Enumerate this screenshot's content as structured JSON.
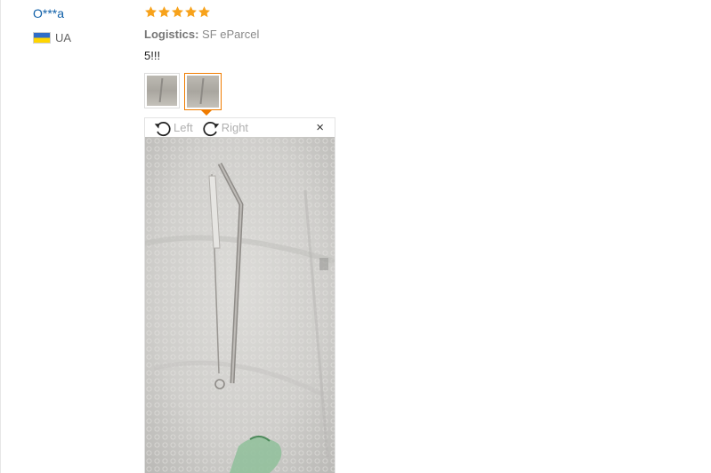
{
  "review": {
    "user_name": "O***a",
    "country_code": "UA",
    "rating": 5,
    "star_color": "#f7a21b",
    "logistics_label": "Logistics:",
    "logistics_value": "SF eParcel",
    "text": "5!!!"
  },
  "thumbnails": [
    {
      "active": false
    },
    {
      "active": true
    }
  ],
  "viewer": {
    "rotate_left_label": "Left",
    "rotate_right_label": "Right",
    "close_symbol": "×"
  },
  "colors": {
    "accent": "#f07c00",
    "link": "#0f5fa8"
  },
  "icons": [
    "rotate-left-icon",
    "rotate-right-icon",
    "close-icon",
    "ukraine-flag-icon",
    "star-icon"
  ]
}
